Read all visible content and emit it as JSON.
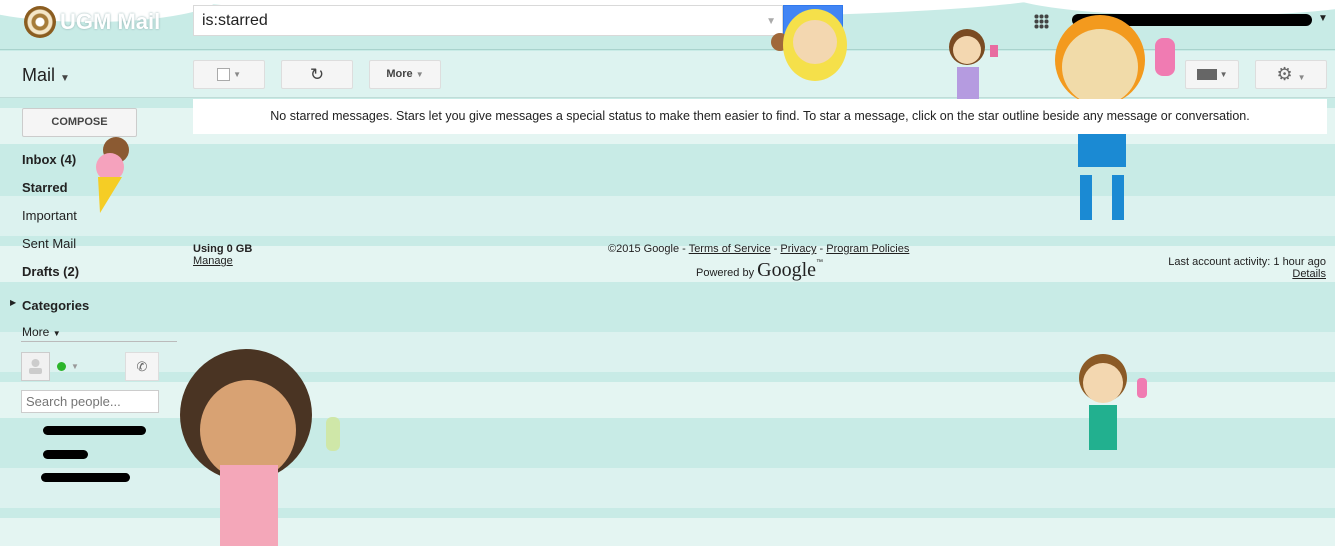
{
  "header": {
    "logo_text": "UGM Mail",
    "search_value": "is:starred",
    "account_redacted": true
  },
  "toolbar": {
    "app_label": "Mail",
    "more_label": "More"
  },
  "notice": "No starred messages. Stars let you give messages a special status to make them easier to find. To star a message, click on the star outline beside any message or conversation.",
  "sidebar": {
    "compose": "COMPOSE",
    "items": [
      {
        "label": "Inbox (4)",
        "bold": true
      },
      {
        "label": "Starred",
        "bold": true
      },
      {
        "label": "Important",
        "bold": false
      },
      {
        "label": "Sent Mail",
        "bold": false
      },
      {
        "label": "Drafts (2)",
        "bold": true
      },
      {
        "label": "Categories",
        "bold": true
      },
      {
        "label": "More",
        "bold": false
      }
    ],
    "search_people_placeholder": "Search people...",
    "status_color": "#2bb52b"
  },
  "footer": {
    "storage": "Using 0 GB",
    "manage": "Manage",
    "copyright": "©2015 Google - ",
    "terms": "Terms of Service",
    "sep": " - ",
    "privacy": "Privacy",
    "policies": "Program Policies",
    "powered": "Powered by",
    "google": "Google",
    "tm": "™",
    "activity": "Last account activity: 1 hour ago",
    "details": "Details"
  },
  "colors": {
    "accent": "#4285f4",
    "bg_dark": "#c8ebe6",
    "bg_light": "#dcf2ef"
  }
}
